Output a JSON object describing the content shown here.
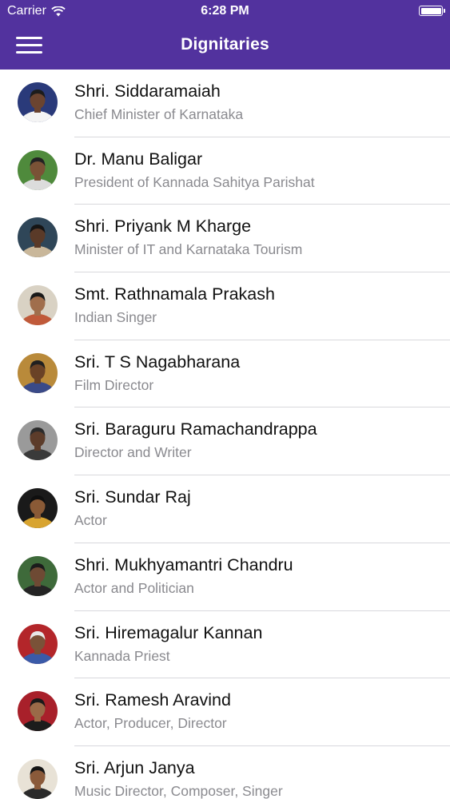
{
  "status_bar": {
    "carrier": "Carrier",
    "time": "6:28 PM",
    "icons": [
      "wifi-icon",
      "battery-icon"
    ]
  },
  "nav": {
    "title": "Dignitaries",
    "menu_icon": "hamburger-menu-icon",
    "bar_color": "#52329e"
  },
  "dignitaries": [
    {
      "name": "Shri. Siddaramaiah",
      "role": "Chief Minister of Karnataka",
      "avatar": {
        "bg": "#2a3a7a",
        "skin": "#6b4430",
        "hair": "#1c1c1c",
        "shirt": "#f4f4f4"
      }
    },
    {
      "name": "Dr. Manu Baligar",
      "role": "President of Kannada Sahitya Parishat",
      "avatar": {
        "bg": "#4f8a3c",
        "skin": "#7a5236",
        "hair": "#222222",
        "shirt": "#dcdcdc"
      }
    },
    {
      "name": "Shri. Priyank M Kharge",
      "role": "Minister of IT and Karnataka Tourism",
      "avatar": {
        "bg": "#2f4658",
        "skin": "#5a3a28",
        "hair": "#151515",
        "shirt": "#c9b79a"
      }
    },
    {
      "name": "Smt. Rathnamala Prakash",
      "role": "Indian Singer",
      "avatar": {
        "bg": "#d9d2c4",
        "skin": "#a06e4c",
        "hair": "#1a1a1a",
        "shirt": "#c05a3a"
      }
    },
    {
      "name": "Sri. T S Nagabharana",
      "role": "Film Director",
      "avatar": {
        "bg": "#b98a3a",
        "skin": "#6a4226",
        "hair": "#202020",
        "shirt": "#3a4a88"
      }
    },
    {
      "name": "Sri. Baraguru Ramachandrappa",
      "role": "Director and Writer",
      "avatar": {
        "bg": "#9a9a9a",
        "skin": "#5c3c2a",
        "hair": "#2b2b2b",
        "shirt": "#3a3a3a"
      }
    },
    {
      "name": "Sri. Sundar Raj",
      "role": "Actor",
      "avatar": {
        "bg": "#1a1a1a",
        "skin": "#8a5a36",
        "hair": "#0f0f0f",
        "shirt": "#d8a430"
      }
    },
    {
      "name": "Shri. Mukhyamantri Chandru",
      "role": "Actor and Politician",
      "avatar": {
        "bg": "#3e6a3a",
        "skin": "#6e4a34",
        "hair": "#1b1b1b",
        "shirt": "#242424"
      }
    },
    {
      "name": "Sri. Hiremagalur Kannan",
      "role": "Kannada Priest",
      "avatar": {
        "bg": "#b3262a",
        "skin": "#7a5238",
        "hair": "#e8e8e8",
        "shirt": "#3a5aa8"
      }
    },
    {
      "name": "Sri. Ramesh Aravind",
      "role": "Actor, Producer, Director",
      "avatar": {
        "bg": "#a8202a",
        "skin": "#9a6a48",
        "hair": "#1a1a1a",
        "shirt": "#1c1c1c"
      }
    },
    {
      "name": "Sri. Arjun Janya",
      "role": "Music Director, Composer, Singer",
      "avatar": {
        "bg": "#e8e2d6",
        "skin": "#8a5a3a",
        "hair": "#151515",
        "shirt": "#2a2a2a"
      }
    }
  ]
}
